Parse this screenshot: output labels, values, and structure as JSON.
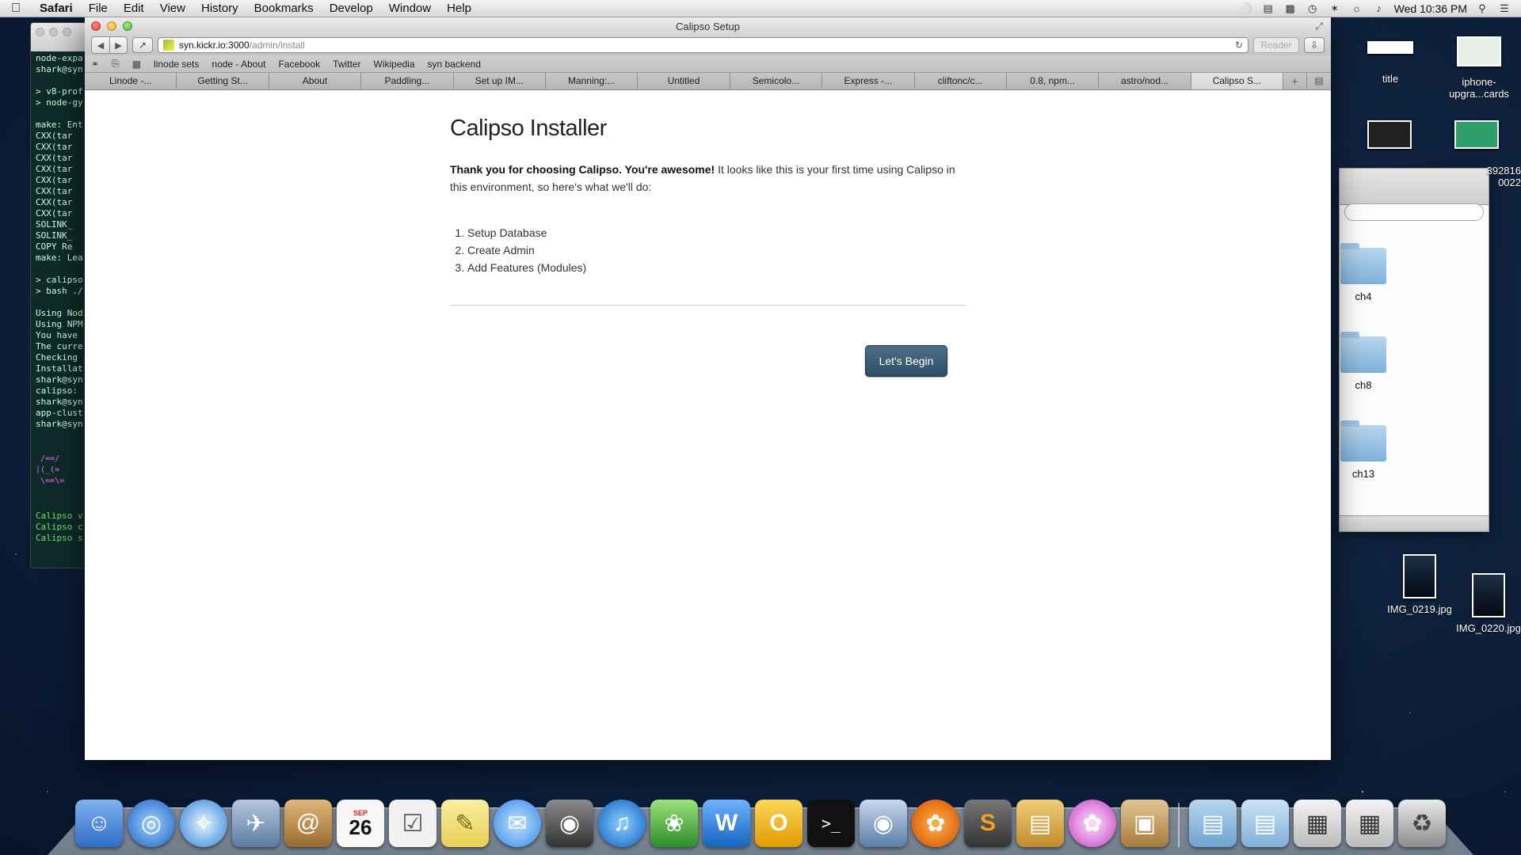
{
  "menubar": {
    "apple": "",
    "app": "Safari",
    "items": [
      "File",
      "Edit",
      "View",
      "History",
      "Bookmarks",
      "Develop",
      "Window",
      "Help"
    ],
    "clock": "Wed 10:36 PM"
  },
  "terminal": {
    "lines": [
      "node-expa",
      "shark@syn",
      "",
      "> v8-prof",
      "> node-gy",
      "",
      "make: Ent",
      "  CXX(tar",
      "  CXX(tar",
      "  CXX(tar",
      "  CXX(tar",
      "  CXX(tar",
      "  CXX(tar",
      "  CXX(tar",
      "  CXX(tar",
      "  SOLINK_",
      "  SOLINK_",
      "  COPY Re",
      "make: Lea",
      "",
      "> calipso",
      "> bash ./",
      "",
      "Using Nod",
      "Using NPM",
      "You have ",
      "The curre",
      "Checking ",
      "Installat",
      "shark@syn",
      "calipso: ",
      "shark@syn",
      "app-clust",
      "shark@syn"
    ],
    "green_lines": [
      "Calipso v",
      "Calipso c",
      "Calipso s"
    ]
  },
  "finder": {
    "folders": [
      "ch4",
      "ch8",
      "ch13"
    ]
  },
  "desktop": {
    "icons": [
      "title",
      "iphone-upgra...cards",
      "392816 0022",
      "IMG_0219.jpg",
      "IMG_0220.jpg"
    ]
  },
  "window": {
    "title": "Calipso Setup",
    "url_host": "syn.kickr.io:3000",
    "url_path": "/admin/install",
    "reader": "Reader",
    "bookmarks": [
      "linode sets",
      "node - About",
      "Facebook",
      "Twitter",
      "Wikipedia",
      "syn backend"
    ],
    "tabs": [
      "Linode -...",
      "Getting St...",
      "About",
      "Paddling...",
      "Set up IM...",
      "Manning:...",
      "Untitled",
      "Semicolo...",
      "Express -...",
      "cliftonc/c...",
      "0.8, npm...",
      "astro/nod...",
      "Calipso S..."
    ],
    "active_tab": 12
  },
  "installer": {
    "heading": "Calipso Installer",
    "intro_bold": "Thank you for choosing Calipso. You're awesome!",
    "intro_rest": " It looks like this is your first time using Calipso in this environment, so here's what we'll do:",
    "steps": [
      "Setup Database",
      "Create Admin",
      "Add Features (Modules)"
    ],
    "button": "Let's Begin"
  },
  "dock": {
    "items": [
      "finder-icon",
      "network-icon",
      "safari-icon",
      "mail-icon",
      "address-book-icon",
      "calendar-icon",
      "reminders-icon",
      "notes-icon",
      "messages-icon",
      "facetime-icon",
      "itunes-icon",
      "leaf-icon",
      "word-icon",
      "outlook-icon",
      "terminal-icon",
      "preview-icon",
      "firefox-icon",
      "sublime-icon",
      "folder-app-icon",
      "flower-icon",
      "archive-icon"
    ],
    "calendar_day": "26",
    "calendar_month": "SEP",
    "colors": {
      "finder": "#3a7bd5",
      "network": "#2a6fd6",
      "safari": "#1e88e5",
      "mail": "#6d88b0",
      "address": "#b8894d",
      "calendar": "#f5f5f5",
      "reminders": "#f0f0f0",
      "notes": "#f3e08a",
      "messages": "#4aa3f0",
      "facetime": "#333",
      "itunes": "#1a73c9",
      "leaf": "#4caf50",
      "word": "#2b7de9",
      "outlook": "#f0b000",
      "terminal": "#222",
      "preview": "#7a9cc4",
      "firefox": "#e66000",
      "sublime": "#555",
      "folderapp": "#d9a441",
      "flower": "#d45fd4",
      "archive": "#c6a06a"
    }
  }
}
